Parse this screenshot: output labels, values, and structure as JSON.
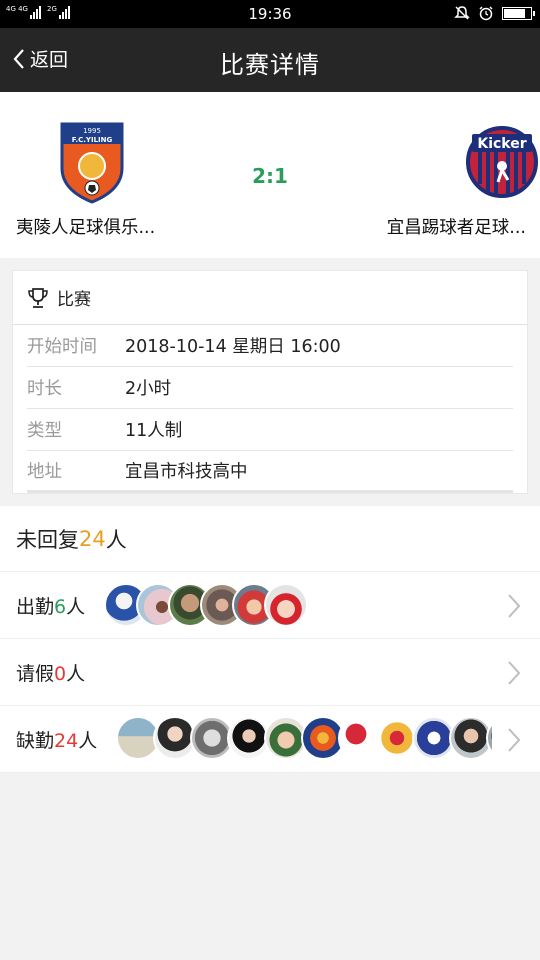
{
  "status": {
    "signal1_tag": "4G 4G",
    "signal2_tag": "2G",
    "time": "19:36",
    "battery_level": 0.8
  },
  "nav": {
    "back_label": "返回",
    "title": "比赛详情"
  },
  "match": {
    "home_name": "夷陵人足球俱乐...",
    "away_name": "宜昌踢球者足球...",
    "score": "2:1",
    "home_logo_text": "F.C.YILING",
    "home_logo_year": "1995",
    "away_logo_text": "Kicker"
  },
  "info": {
    "section_title": "比赛",
    "rows": [
      {
        "label": "开始时间",
        "value": "2018-10-14 星期日 16:00"
      },
      {
        "label": "时长",
        "value": "2小时"
      },
      {
        "label": "类型",
        "value": "11人制"
      },
      {
        "label": "地址",
        "value": "宜昌市科技高中"
      }
    ]
  },
  "reply": {
    "prefix": "未回复",
    "count": "24",
    "suffix": "人"
  },
  "attendance": {
    "present": {
      "prefix": "出勤",
      "count": "6",
      "suffix": "人"
    },
    "leave": {
      "prefix": "请假",
      "count": "0",
      "suffix": "人"
    },
    "absent": {
      "prefix": "缺勤",
      "count": "24",
      "suffix": "人"
    }
  },
  "colors": {
    "score_green": "#2a9d5b",
    "count_orange": "#e8a020",
    "count_red": "#e53935",
    "nav_bg": "#262626"
  }
}
